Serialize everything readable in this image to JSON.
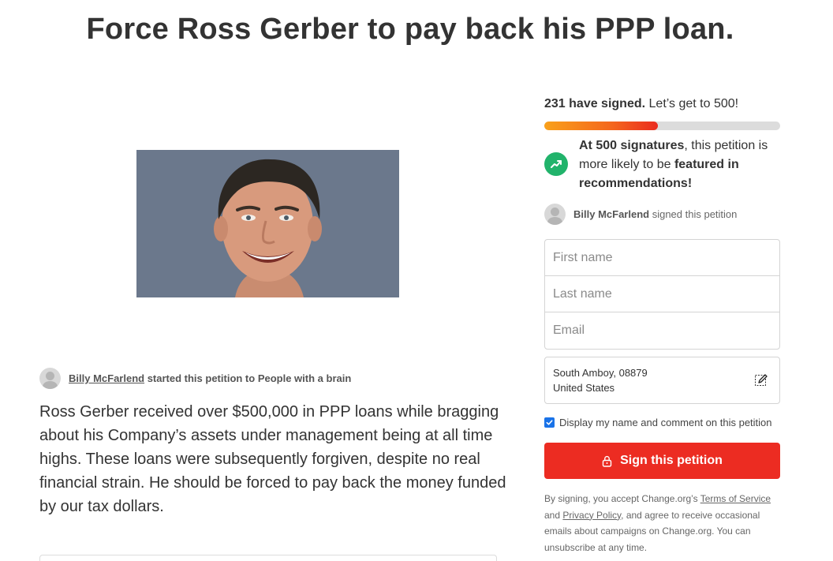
{
  "title": "Force Ross Gerber to pay back his PPP loan.",
  "starter": {
    "name": "Billy McFarlend",
    "text": "started this petition to People with a brain"
  },
  "description": "Ross Gerber received over $500,000 in PPP loans while bragging about his Company’s assets under management being at all time highs. These loans were subsequently forgiven, despite no real financial strain. He should be forced to pay back the money funded by our tax dollars.",
  "progress": {
    "count_text": "231 have signed.",
    "goal_text": "Let’s get to 500!",
    "fraction": 0.48
  },
  "milestone": {
    "strong1": "At 500 signatures",
    "text1": ", this petition is more likely to be ",
    "strong2": "featured in recommendations!"
  },
  "recent_signer": {
    "name": "Billy McFarlend",
    "text": "signed this petition"
  },
  "form": {
    "first_name_placeholder": "First name",
    "last_name_placeholder": "Last name",
    "email_placeholder": "Email",
    "location_line1": "South Amboy, 08879",
    "location_line2": "United States",
    "display_consent": "Display my name and comment on this petition",
    "display_checked": true,
    "submit_label": "Sign this petition"
  },
  "legal": {
    "pre": "By signing, you accept Change.org’s ",
    "terms": "Terms of Service",
    "and": " and ",
    "privacy": "Privacy Policy",
    "post": ", and agree to receive occasional emails about campaigns on Change.org. You can unsubscribe at any time."
  },
  "colors": {
    "accent_red": "#ec2c22",
    "progress_start": "#f9a11b",
    "progress_end": "#ea2b1f",
    "milestone_green": "#21b36b",
    "checkbox_blue": "#1a73e8"
  },
  "icons": {
    "milestone": "trending-up-icon",
    "lock": "lock-icon",
    "edit": "edit-icon"
  }
}
